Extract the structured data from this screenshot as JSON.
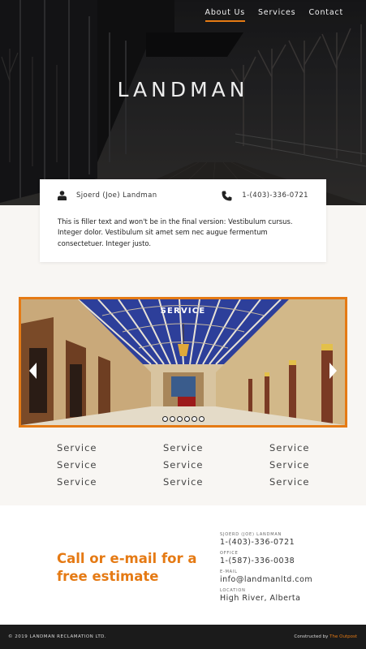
{
  "nav": {
    "items": [
      {
        "label": "About Us",
        "active": true
      },
      {
        "label": "Services",
        "active": false
      },
      {
        "label": "Contact",
        "active": false
      }
    ]
  },
  "hero": {
    "brand": "LANDMAN"
  },
  "card": {
    "name": "Sjoerd (Joe) Landman",
    "phone": "1-(403)-336-0721",
    "text": "This is filler text and won't be in the final version: Vestibulum cursus. Integer dolor. Vestibulum sit amet sem nec augue fermentum consectetuer. Integer justo.",
    "person_icon": "person-icon",
    "phone_icon": "phone-icon"
  },
  "slider": {
    "title": "SERVICE",
    "slide_count": 6,
    "active_index": 0
  },
  "services": [
    "Service",
    "Service",
    "Service",
    "Service",
    "Service",
    "Service",
    "Service",
    "Service",
    "Service"
  ],
  "contact": {
    "cta": "Call or e-mail for a free estimate",
    "items": [
      {
        "label": "SJOERD (JOE) LANDMAN",
        "value": "1-(403)-336-0721"
      },
      {
        "label": "OFFICE",
        "value": "1-(587)-336-0038"
      },
      {
        "label": "E-MAIL",
        "value": "info@landmanltd.com"
      },
      {
        "label": "LOCATION",
        "value": "High River, Alberta"
      }
    ]
  },
  "footer": {
    "copyright": "© 2019 LANDMAN RECLAMATION LTD.",
    "built_prefix": "Constructed by ",
    "built_link": "The Outpost"
  },
  "colors": {
    "accent": "#e57a14",
    "footer_bg": "#1b1b1b",
    "section_bg": "#f8f6f3"
  }
}
